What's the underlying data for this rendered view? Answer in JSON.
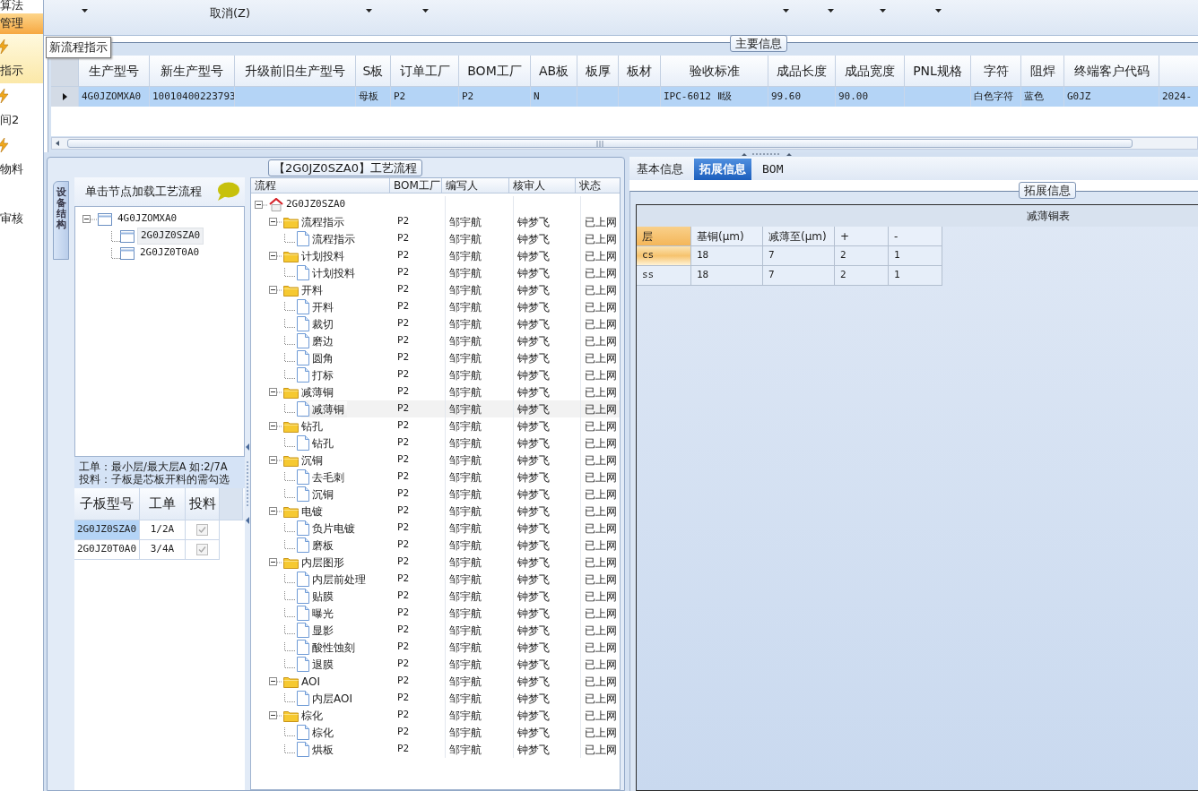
{
  "sidebar": {
    "items": [
      {
        "label": "算法",
        "kind": "small",
        "selected": false,
        "hovered": false
      },
      {
        "label": "管理",
        "kind": "small",
        "selected": true,
        "hovered": false
      },
      {
        "label": "指示",
        "kind": "large",
        "selected": false,
        "hovered": true
      },
      {
        "label": "间2",
        "kind": "large",
        "selected": false,
        "hovered": false
      },
      {
        "label": "物料",
        "kind": "large",
        "selected": false,
        "hovered": false
      },
      {
        "label": "审核",
        "kind": "small",
        "selected": false,
        "hovered": false
      }
    ]
  },
  "tooltip": "新流程指示",
  "ribbon": {
    "label": "取消(Z)"
  },
  "main_info": {
    "legend": "主要信息",
    "columns": [
      "生产型号",
      "新生产型号",
      "升级前旧生产型号",
      "S板",
      "订单工厂",
      "BOM工厂",
      "AB板",
      "板厚",
      "板材",
      "验收标准",
      "成品长度",
      "成品宽度",
      "PNL规格",
      "字符",
      "阻焊",
      "终端客户代码"
    ],
    "rows": [
      {
        "selected": true,
        "cells": [
          "4G0JZOMXA0",
          "10010400223793",
          null,
          "母板",
          "P2",
          "P2",
          "N",
          null,
          null,
          "IPC-6012 Ⅱ级",
          "99.60",
          "90.00",
          null,
          "白色字符",
          "蓝色",
          "G0JZ",
          "2024-"
        ]
      }
    ]
  },
  "process_flow": {
    "title": "【2G0JZ0SZA0】工艺流程",
    "side_tab": "设备结构",
    "hint": "单击节点加载工艺流程",
    "structure": [
      {
        "label": "4G0JZOMXA0",
        "selected": false,
        "children": [
          {
            "label": "2G0JZ0SZA0",
            "selected": true
          },
          {
            "label": "2G0JZ0T0A0",
            "selected": false
          }
        ]
      }
    ],
    "notes": [
      "工单：最小层/最大层A 如:2/7A",
      "投料：子板是芯板开料的需勾选"
    ],
    "sub_boards": {
      "columns": [
        "子板型号",
        "工单",
        "投料"
      ],
      "rows": [
        {
          "model": "2G0JZ0SZA0",
          "order": "1/2A",
          "fed": true,
          "selected": true
        },
        {
          "model": "2G0JZ0T0A0",
          "order": "3/4A",
          "fed": true,
          "selected": false
        }
      ]
    },
    "flow_grid": {
      "columns": [
        "流程",
        "BOM工厂",
        "编写人",
        "核审人",
        "状态"
      ],
      "tree": [
        {
          "label": "2G0JZ0SZA0",
          "kind": "root",
          "selected": false,
          "children": [
            {
              "label": "流程指示",
              "kind": "folder",
              "bom": "P2",
              "writer": "邹宇航",
              "reviewer": "钟梦飞",
              "status": "已上网",
              "selected": false,
              "children": [
                {
                  "label": "流程指示",
                  "kind": "step",
                  "bom": "P2",
                  "writer": "邹宇航",
                  "reviewer": "钟梦飞",
                  "status": "已上网",
                  "selected": false
                }
              ]
            },
            {
              "label": "计划投料",
              "kind": "folder",
              "bom": "P2",
              "writer": "邹宇航",
              "reviewer": "钟梦飞",
              "status": "已上网",
              "selected": false,
              "children": [
                {
                  "label": "计划投料",
                  "kind": "step",
                  "bom": "P2",
                  "writer": "邹宇航",
                  "reviewer": "钟梦飞",
                  "status": "已上网",
                  "selected": false
                }
              ]
            },
            {
              "label": "开料",
              "kind": "folder",
              "bom": "P2",
              "writer": "邹宇航",
              "reviewer": "钟梦飞",
              "status": "已上网",
              "selected": false,
              "children": [
                {
                  "label": "开料",
                  "kind": "step",
                  "bom": "P2",
                  "writer": "邹宇航",
                  "reviewer": "钟梦飞",
                  "status": "已上网",
                  "selected": false
                },
                {
                  "label": "裁切",
                  "kind": "step",
                  "bom": "P2",
                  "writer": "邹宇航",
                  "reviewer": "钟梦飞",
                  "status": "已上网",
                  "selected": false
                },
                {
                  "label": "磨边",
                  "kind": "step",
                  "bom": "P2",
                  "writer": "邹宇航",
                  "reviewer": "钟梦飞",
                  "status": "已上网",
                  "selected": false
                },
                {
                  "label": "圆角",
                  "kind": "step",
                  "bom": "P2",
                  "writer": "邹宇航",
                  "reviewer": "钟梦飞",
                  "status": "已上网",
                  "selected": false
                },
                {
                  "label": "打标",
                  "kind": "step",
                  "bom": "P2",
                  "writer": "邹宇航",
                  "reviewer": "钟梦飞",
                  "status": "已上网",
                  "selected": false
                }
              ]
            },
            {
              "label": "减薄铜",
              "kind": "folder",
              "bom": "P2",
              "writer": "邹宇航",
              "reviewer": "钟梦飞",
              "status": "已上网",
              "selected": false,
              "children": [
                {
                  "label": "减薄铜",
                  "kind": "step",
                  "bom": "P2",
                  "writer": "邹宇航",
                  "reviewer": "钟梦飞",
                  "status": "已上网",
                  "selected": true
                }
              ]
            },
            {
              "label": "钻孔",
              "kind": "folder",
              "bom": "P2",
              "writer": "邹宇航",
              "reviewer": "钟梦飞",
              "status": "已上网",
              "selected": false,
              "children": [
                {
                  "label": "钻孔",
                  "kind": "step",
                  "bom": "P2",
                  "writer": "邹宇航",
                  "reviewer": "钟梦飞",
                  "status": "已上网",
                  "selected": false
                }
              ]
            },
            {
              "label": "沉铜",
              "kind": "folder",
              "bom": "P2",
              "writer": "邹宇航",
              "reviewer": "钟梦飞",
              "status": "已上网",
              "selected": false,
              "children": [
                {
                  "label": "去毛刺",
                  "kind": "step",
                  "bom": "P2",
                  "writer": "邹宇航",
                  "reviewer": "钟梦飞",
                  "status": "已上网",
                  "selected": false
                },
                {
                  "label": "沉铜",
                  "kind": "step",
                  "bom": "P2",
                  "writer": "邹宇航",
                  "reviewer": "钟梦飞",
                  "status": "已上网",
                  "selected": false
                }
              ]
            },
            {
              "label": "电镀",
              "kind": "folder",
              "bom": "P2",
              "writer": "邹宇航",
              "reviewer": "钟梦飞",
              "status": "已上网",
              "selected": false,
              "children": [
                {
                  "label": "负片电镀",
                  "kind": "step",
                  "bom": "P2",
                  "writer": "邹宇航",
                  "reviewer": "钟梦飞",
                  "status": "已上网",
                  "selected": false
                },
                {
                  "label": "磨板",
                  "kind": "step",
                  "bom": "P2",
                  "writer": "邹宇航",
                  "reviewer": "钟梦飞",
                  "status": "已上网",
                  "selected": false
                }
              ]
            },
            {
              "label": "内层图形",
              "kind": "folder",
              "bom": "P2",
              "writer": "邹宇航",
              "reviewer": "钟梦飞",
              "status": "已上网",
              "selected": false,
              "children": [
                {
                  "label": "内层前处理",
                  "kind": "step",
                  "bom": "P2",
                  "writer": "邹宇航",
                  "reviewer": "钟梦飞",
                  "status": "已上网",
                  "selected": false
                },
                {
                  "label": "贴膜",
                  "kind": "step",
                  "bom": "P2",
                  "writer": "邹宇航",
                  "reviewer": "钟梦飞",
                  "status": "已上网",
                  "selected": false
                },
                {
                  "label": "曝光",
                  "kind": "step",
                  "bom": "P2",
                  "writer": "邹宇航",
                  "reviewer": "钟梦飞",
                  "status": "已上网",
                  "selected": false
                },
                {
                  "label": "显影",
                  "kind": "step",
                  "bom": "P2",
                  "writer": "邹宇航",
                  "reviewer": "钟梦飞",
                  "status": "已上网",
                  "selected": false
                },
                {
                  "label": "酸性蚀刻",
                  "kind": "step",
                  "bom": "P2",
                  "writer": "邹宇航",
                  "reviewer": "钟梦飞",
                  "status": "已上网",
                  "selected": false
                },
                {
                  "label": "退膜",
                  "kind": "step",
                  "bom": "P2",
                  "writer": "邹宇航",
                  "reviewer": "钟梦飞",
                  "status": "已上网",
                  "selected": false
                }
              ]
            },
            {
              "label": "AOI",
              "kind": "folder",
              "bom": "P2",
              "writer": "邹宇航",
              "reviewer": "钟梦飞",
              "status": "已上网",
              "selected": false,
              "children": [
                {
                  "label": "内层AOI",
                  "kind": "step",
                  "bom": "P2",
                  "writer": "邹宇航",
                  "reviewer": "钟梦飞",
                  "status": "已上网",
                  "selected": false
                }
              ]
            },
            {
              "label": "棕化",
              "kind": "folder",
              "bom": "P2",
              "writer": "邹宇航",
              "reviewer": "钟梦飞",
              "status": "已上网",
              "selected": false,
              "children": [
                {
                  "label": "棕化",
                  "kind": "step",
                  "bom": "P2",
                  "writer": "邹宇航",
                  "reviewer": "钟梦飞",
                  "status": "已上网",
                  "selected": false
                },
                {
                  "label": "烘板",
                  "kind": "step",
                  "bom": "P2",
                  "writer": "邹宇航",
                  "reviewer": "钟梦飞",
                  "status": "已上网",
                  "selected": false
                }
              ]
            }
          ]
        }
      ]
    }
  },
  "detail_tabs": [
    {
      "label": "基本信息",
      "selected": false
    },
    {
      "label": "拓展信息",
      "selected": true
    },
    {
      "label": "BOM",
      "selected": false
    }
  ],
  "extended_info": {
    "legend": "拓展信息",
    "table_title": "减薄铜表",
    "columns": [
      "层",
      "基铜(μm)",
      "减薄至(μm)",
      "+",
      "-"
    ],
    "rows": [
      {
        "selected": true,
        "cells": [
          "cs",
          "18",
          "7",
          "2",
          "1"
        ]
      },
      {
        "selected": false,
        "cells": [
          "ss",
          "18",
          "7",
          "2",
          "1"
        ]
      }
    ]
  }
}
